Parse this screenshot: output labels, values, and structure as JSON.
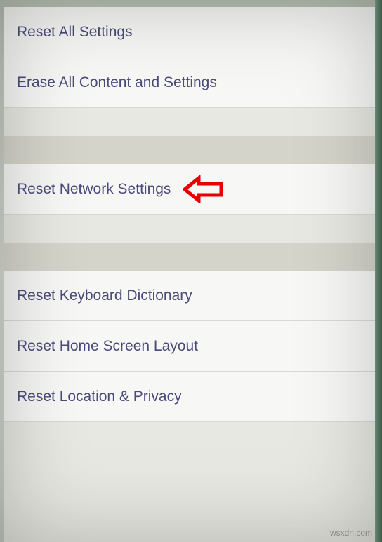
{
  "groups": {
    "g1": {
      "item0": "Reset All Settings",
      "item1": "Erase All Content and Settings"
    },
    "g2": {
      "item0": "Reset Network Settings"
    },
    "g3": {
      "item0": "Reset Keyboard Dictionary",
      "item1": "Reset Home Screen Layout",
      "item2": "Reset Location & Privacy"
    }
  },
  "watermark": "wsxdn.com"
}
